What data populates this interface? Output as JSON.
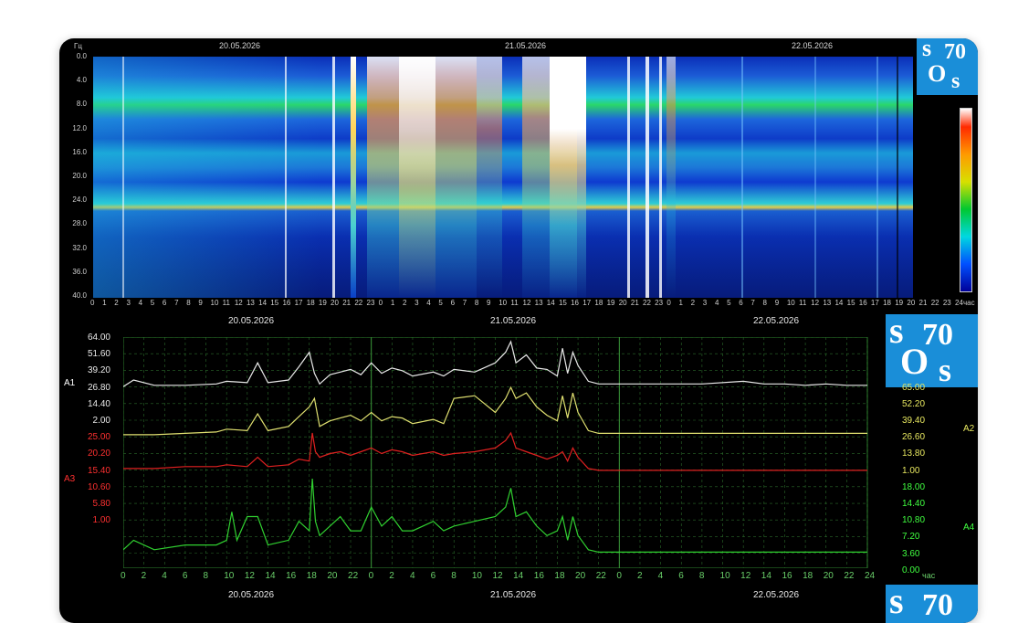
{
  "spectrogram": {
    "freq_unit": "Гц",
    "hour_unit": "час",
    "dates": [
      "20.05.2026",
      "21.05.2026",
      "22.05.2026"
    ],
    "freq_ticks": [
      "0.0",
      "4.0",
      "8.0",
      "12.0",
      "16.0",
      "20.0",
      "24.0",
      "28.0",
      "32.0",
      "36.0",
      "40.0"
    ],
    "hour_ticks": [
      "0",
      "1",
      "2",
      "3",
      "4",
      "5",
      "6",
      "7",
      "8",
      "9",
      "10",
      "11",
      "12",
      "13",
      "14",
      "15",
      "16",
      "17",
      "18",
      "19",
      "20",
      "21",
      "22",
      "23",
      "0",
      "1",
      "2",
      "3",
      "4",
      "5",
      "6",
      "7",
      "8",
      "9",
      "10",
      "11",
      "12",
      "13",
      "14",
      "15",
      "16",
      "17",
      "18",
      "19",
      "20",
      "21",
      "22",
      "23",
      "0",
      "1",
      "2",
      "3",
      "4",
      "5",
      "6",
      "7",
      "8",
      "9",
      "10",
      "11",
      "12",
      "13",
      "14",
      "15",
      "16",
      "17",
      "18",
      "19",
      "20",
      "21",
      "22",
      "23",
      "24"
    ],
    "logo": {
      "s1": "s",
      "n": "70",
      "o": "O",
      "s2": "s"
    }
  },
  "chart_data": {
    "type": "line",
    "title": "",
    "dates": [
      "20.05.2026",
      "21.05.2026",
      "22.05.2026"
    ],
    "x_unit": "час",
    "x_ticks": [
      "0",
      "2",
      "4",
      "6",
      "8",
      "10",
      "12",
      "14",
      "16",
      "18",
      "20",
      "22",
      "0",
      "2",
      "4",
      "6",
      "8",
      "10",
      "12",
      "14",
      "16",
      "18",
      "20",
      "22",
      "0",
      "2",
      "4",
      "6",
      "8",
      "10",
      "12",
      "14",
      "16",
      "18",
      "20",
      "22",
      "24"
    ],
    "x_range_hours": [
      0,
      72
    ],
    "left_axis_A1": {
      "label": "A1",
      "ticks": [
        "64.00",
        "51.60",
        "39.20",
        "26.80",
        "14.40",
        "2.00"
      ],
      "color": "#ffffff"
    },
    "left_axis_A3": {
      "label": "A3",
      "ticks": [
        "25.00",
        "20.20",
        "15.40",
        "10.60",
        "5.80",
        "1.00"
      ],
      "color": "#ff3030"
    },
    "right_axis_A2": {
      "label": "A2",
      "ticks": [
        "65.00",
        "52.20",
        "39.40",
        "26.60",
        "13.80",
        "1.00"
      ],
      "color": "#e8e860"
    },
    "right_axis_A4": {
      "label": "A4",
      "ticks": [
        "18.00",
        "14.40",
        "10.80",
        "7.20",
        "3.60",
        "0.00"
      ],
      "color": "#40ff40"
    },
    "grid": true,
    "series": [
      {
        "name": "A1",
        "color": "#e8e8e8",
        "x": [
          0,
          1,
          3,
          6,
          9,
          10,
          12,
          13,
          14,
          16,
          17,
          18,
          18.5,
          19,
          20,
          21,
          22,
          23,
          24,
          25,
          26,
          27,
          28,
          30,
          31,
          32,
          34,
          36,
          37,
          37.5,
          38,
          39,
          40,
          41,
          42,
          42.5,
          43,
          43.5,
          44,
          45,
          46,
          47,
          48,
          52,
          56,
          60,
          62,
          64,
          66,
          68,
          70,
          72
        ],
        "y": [
          4,
          9,
          5,
          5,
          6,
          8,
          7,
          22,
          7,
          9,
          19,
          30,
          14,
          6,
          13,
          15,
          17,
          13,
          22,
          14,
          18,
          16,
          12,
          15,
          12,
          17,
          15,
          22,
          30,
          38,
          22,
          28,
          18,
          17,
          12,
          33,
          14,
          30,
          20,
          8,
          6,
          6,
          6,
          6,
          6,
          8,
          6,
          6,
          5,
          6,
          5,
          5
        ]
      },
      {
        "name": "A2",
        "color": "#e0e070",
        "x": [
          0,
          3,
          6,
          9,
          10,
          12,
          13,
          14,
          16,
          17,
          18,
          18.5,
          19,
          20,
          21,
          22,
          23,
          24,
          25,
          26,
          27,
          28,
          30,
          31,
          32,
          34,
          36,
          37,
          37.5,
          38,
          39,
          40,
          41,
          42,
          42.5,
          43,
          43.5,
          44,
          45,
          46,
          48,
          52,
          56,
          60,
          64,
          68,
          72
        ],
        "y": [
          2,
          2,
          3,
          4,
          6,
          5,
          17,
          5,
          8,
          15,
          22,
          28,
          8,
          12,
          14,
          16,
          12,
          18,
          12,
          15,
          14,
          10,
          13,
          10,
          28,
          30,
          18,
          28,
          36,
          28,
          32,
          22,
          16,
          12,
          30,
          14,
          32,
          18,
          5,
          3,
          3,
          3,
          3,
          3,
          3,
          3,
          3
        ]
      },
      {
        "name": "A3",
        "color": "#e02020",
        "x": [
          0,
          3,
          6,
          9,
          10,
          12,
          13,
          14,
          16,
          17,
          18,
          18.3,
          18.6,
          19,
          20,
          21,
          22,
          23,
          24,
          25,
          26,
          27,
          28,
          30,
          31,
          32,
          34,
          36,
          37,
          37.5,
          38,
          39,
          40,
          41,
          42,
          42.5,
          43,
          43.5,
          44,
          45,
          46,
          48,
          52,
          56,
          60,
          64,
          68,
          72
        ],
        "y": [
          3,
          3,
          4,
          4,
          5,
          4,
          9,
          4,
          5,
          8,
          7,
          22,
          12,
          9,
          11,
          12,
          10,
          12,
          14,
          11,
          13,
          12,
          10,
          12,
          10,
          11,
          12,
          14,
          18,
          22,
          14,
          12,
          10,
          8,
          10,
          12,
          7,
          14,
          9,
          3,
          2,
          2,
          2,
          2,
          2,
          2,
          2,
          2
        ]
      },
      {
        "name": "A4",
        "color": "#30d030",
        "x": [
          0,
          1,
          3,
          6,
          9,
          10,
          10.5,
          11,
          12,
          13,
          14,
          16,
          17,
          18,
          18.3,
          18.6,
          19,
          20,
          21,
          22,
          23,
          24,
          25,
          26,
          27,
          28,
          30,
          31,
          32,
          34,
          36,
          37,
          37.5,
          38,
          39,
          40,
          41,
          42,
          42.5,
          43,
          43.5,
          44,
          45,
          46,
          48,
          52,
          56,
          60,
          64,
          68,
          72
        ],
        "y": [
          1,
          3,
          1,
          2,
          2,
          3,
          9,
          3,
          8,
          8,
          2,
          3,
          7,
          5,
          16,
          7,
          4,
          6,
          8,
          5,
          5,
          10,
          6,
          8,
          5,
          5,
          7,
          5,
          6,
          7,
          8,
          10,
          14,
          8,
          9,
          6,
          4,
          5,
          8,
          3,
          8,
          4,
          1,
          0.5,
          0.5,
          0.5,
          0.5,
          0.5,
          0.5,
          0.5,
          0.5
        ]
      }
    ]
  }
}
